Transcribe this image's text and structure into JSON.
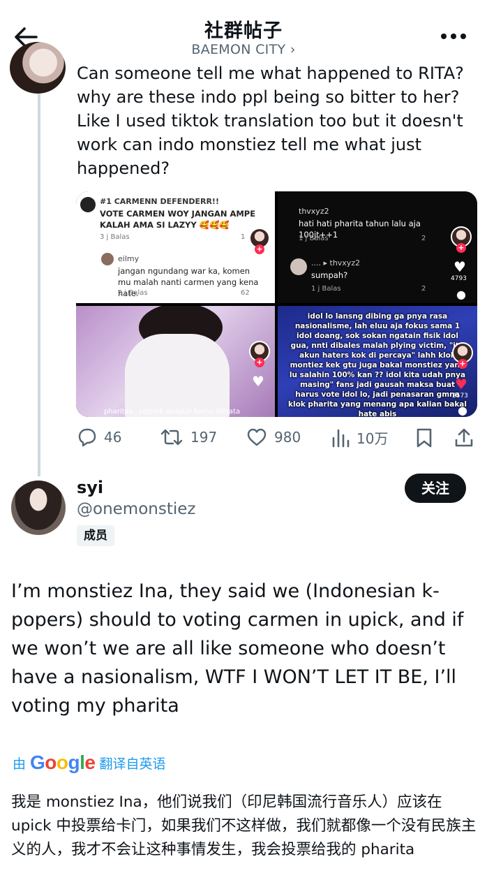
{
  "header": {
    "title": "社群帖子",
    "subtitle": "BAEMON CITY ›"
  },
  "parent_tweet": {
    "text": "Can someone tell me what happened to RITA? why are these indo ppl being so bitter to her? Like I used tiktok translation too but it doesn't work can indo monstiez tell me what just happened?",
    "media": {
      "cell1": {
        "c1_name": "#1 CARMENN DEFENDERR!!",
        "c1_text": "VOTE CARMEN WOY JANGAN AMPE KALAH AMA SI LAZYY 🥰🥰🥰",
        "c1_meta": "3 j      Balas",
        "c1_likes": "1",
        "c2_name": "eilmy",
        "c2_text": "jangan ngundang war ka, komen mu malah nanti carmen yang kena hate.",
        "c2_meta": "2 j      Balas",
        "c2_likes": "62"
      },
      "cell2": {
        "c1_name": "thvxyz2",
        "c1_text": "hati hati pharita tahun lalu aja 100jt++1",
        "c1_meta": "1 j      Balas",
        "c1_likes": "2",
        "c2_name": "....  ▸ thvxyz2",
        "c2_text": "sumpah?",
        "c2_meta": "1 j      Balas",
        "c2_likes": "2",
        "heart_count": "4793"
      },
      "cell3": {
        "caption": "pharitaa_ sejelek apapun kamu dimata"
      },
      "cell4": {
        "overlay": "idol lo lansng dibing ga pnya rasa nasionalisme, lah eluu aja fokus sama 1 idol doang, sok sokan ngatain fisik idol gua, nnti dibales malah plying victim, \"itu akun haters kok di percaya\" lahh klok montiez kek gtu juga bakal monstiez yang lu salahin 100% kan ?? idol kita udah pnya masing\" fans jadi gausah maksa buat harus vote idol lo, jadi penasaran gmna klok pharita yang menang apa kalian bakal hate abis",
        "heart_count": "2573"
      }
    },
    "actions": {
      "replies": "46",
      "retweets": "197",
      "likes": "980",
      "views": "10万"
    }
  },
  "reply": {
    "name": "syi",
    "handle": "@onemonstiez",
    "badge": "成员",
    "follow_label": "关注",
    "text": "I’m monstiez Ina, they said we (Indonesian k-popers) should to voting carmen in upick, and if we won’t we are all like someone who doesn’t have a nasionalism, WTF I WON’T LET IT BE, I’ll voting my pharita",
    "translate_prefix": "由",
    "translate_brand": "Google",
    "translate_suffix": "翻译自英语",
    "translated_text": "我是 monstiez Ina，他们说我们（印尼韩国流行音乐人）应该在 upick 中投票给卡门，如果我们不这样做，我们就都像一个没有民族主义的人，我才不会让这种事情发生，我会投票给我的 pharita"
  },
  "colors": {
    "accent": "#1d9bf0",
    "text": "#0f1419",
    "muted": "#536471",
    "tiktok_red": "#fe2c55"
  }
}
